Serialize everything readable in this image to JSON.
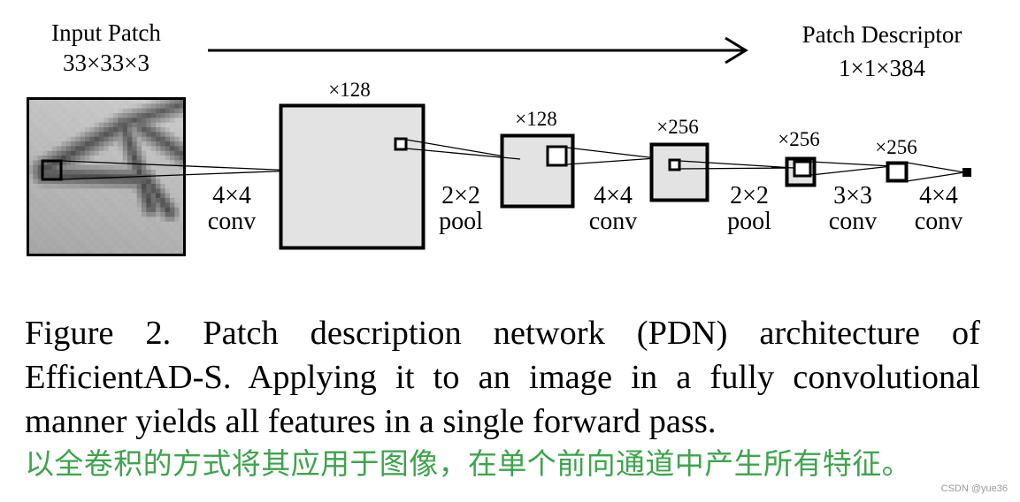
{
  "figure": {
    "input_label": "Input Patch",
    "input_size": "33×33×3",
    "output_label": "Patch Descriptor",
    "output_size": "1×1×384",
    "layers": [
      {
        "channels": "×128"
      },
      {
        "channels": "×128"
      },
      {
        "channels": "×256"
      },
      {
        "channels": "×256"
      },
      {
        "channels": "×256"
      }
    ],
    "operations": [
      {
        "kernel": "4×4",
        "type": "conv"
      },
      {
        "kernel": "2×2",
        "type": "pool"
      },
      {
        "kernel": "4×4",
        "type": "conv"
      },
      {
        "kernel": "2×2",
        "type": "pool"
      },
      {
        "kernel": "3×3",
        "type": "conv"
      },
      {
        "kernel": "4×4",
        "type": "conv"
      }
    ],
    "colors": {
      "box_fill": "#e3e3e3",
      "stroke": "#000000",
      "translation_text": "#3fa34d"
    }
  },
  "caption": {
    "lines": [
      "Figure 2. Patch description network (PDN) architecture of",
      "EfficientAD-S. Applying it to an image in a fully convolutional",
      "manner yields all features in a single forward pass."
    ]
  },
  "translation": "以全卷积的方式将其应用于图像，在单个前向通道中产生所有特征。",
  "watermark": "CSDN @yue36"
}
